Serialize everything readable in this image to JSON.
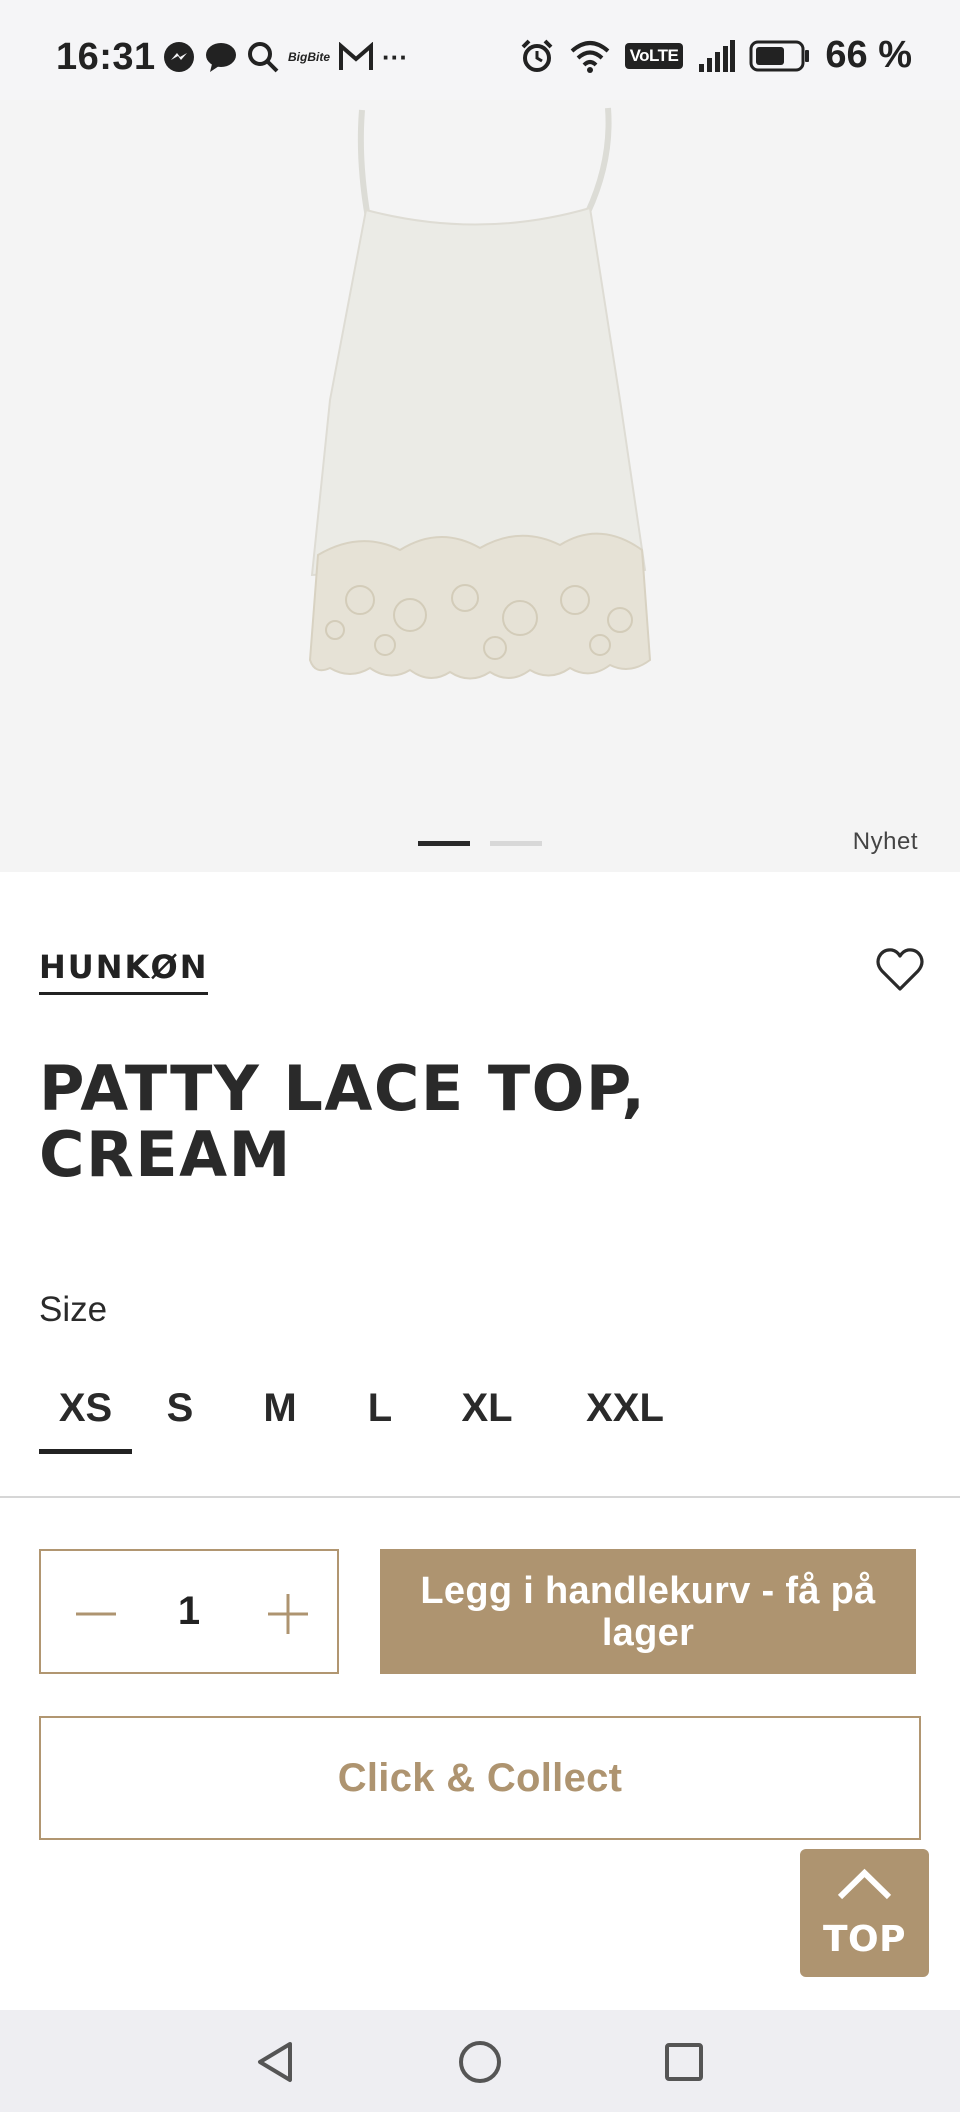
{
  "status_bar": {
    "time": "16:31",
    "left_icons": [
      "messenger-icon",
      "chat-bubble-icon",
      "search-icon",
      "bigbite-icon",
      "gmail-icon",
      "more-icon"
    ],
    "bigbite_text": "BigBite",
    "more_text": "···",
    "right_icons": [
      "alarm-icon",
      "wifi-icon",
      "volte-icon",
      "signal-icon",
      "battery-icon"
    ],
    "volte_text": "VoLTE",
    "battery": "66 %"
  },
  "hero": {
    "image": "product-photo-cream-lace-camisole",
    "badge": "Nyhet",
    "slides": 2,
    "active_slide": 1
  },
  "product": {
    "brand": "HUNKØN",
    "title": "PATTY LACE TOP, CREAM",
    "size_label": "Size",
    "sizes": [
      "XS",
      "S",
      "M",
      "L",
      "XL",
      "XXL"
    ],
    "selected_size": "XS",
    "quantity": "1",
    "add_to_cart": "Legg i handlekurv - få på lager",
    "click_collect": "Click & Collect"
  },
  "top_button": {
    "label": "TOP"
  },
  "colors": {
    "accent": "#ae9470",
    "text": "#2a2a2a",
    "hero_bg": "#f4f4f4"
  },
  "nav_bar": {
    "icons": [
      "back-icon",
      "home-icon",
      "recents-icon"
    ]
  }
}
